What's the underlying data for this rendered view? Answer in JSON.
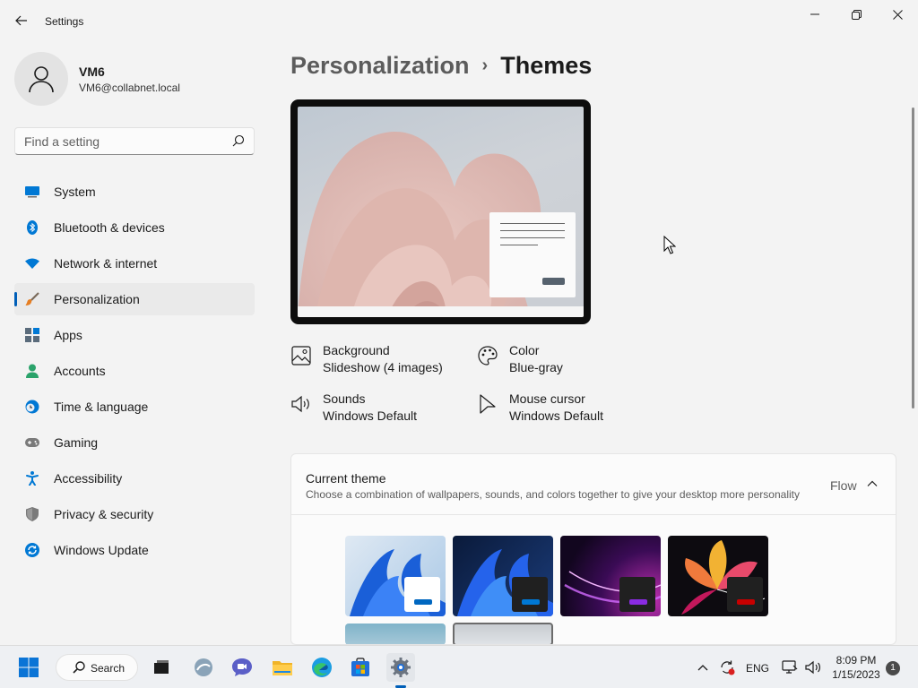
{
  "window": {
    "app_title": "Settings"
  },
  "profile": {
    "name": "VM6",
    "email": "VM6@collabnet.local"
  },
  "search": {
    "placeholder": "Find a setting"
  },
  "sidebar": {
    "items": [
      {
        "label": "System",
        "icon": "system-icon",
        "color": "#0078d4"
      },
      {
        "label": "Bluetooth & devices",
        "icon": "bluetooth-icon",
        "color": "#0078d4"
      },
      {
        "label": "Network & internet",
        "icon": "wifi-icon",
        "color": "#0078d4"
      },
      {
        "label": "Personalization",
        "icon": "paintbrush-icon",
        "color": "#e67e22",
        "active": true
      },
      {
        "label": "Apps",
        "icon": "apps-icon",
        "color": "#5a6b7b"
      },
      {
        "label": "Accounts",
        "icon": "accounts-icon",
        "color": "#2ba36b"
      },
      {
        "label": "Time & language",
        "icon": "clock-globe-icon",
        "color": "#0078d4"
      },
      {
        "label": "Gaming",
        "icon": "gamepad-icon",
        "color": "#6b6b6b"
      },
      {
        "label": "Accessibility",
        "icon": "accessibility-icon",
        "color": "#0078d4"
      },
      {
        "label": "Privacy & security",
        "icon": "shield-icon",
        "color": "#6b6b6b"
      },
      {
        "label": "Windows Update",
        "icon": "update-icon",
        "color": "#0078d4"
      }
    ]
  },
  "breadcrumb": {
    "parent": "Personalization",
    "separator": "›",
    "current": "Themes"
  },
  "properties": {
    "background": {
      "name": "Background",
      "value": "Slideshow (4 images)"
    },
    "color": {
      "name": "Color",
      "value": "Blue-gray"
    },
    "sounds": {
      "name": "Sounds",
      "value": "Windows Default"
    },
    "mouse_cursor": {
      "name": "Mouse cursor",
      "value": "Windows Default"
    }
  },
  "current_theme": {
    "title": "Current theme",
    "subtitle": "Choose a combination of wallpapers, sounds, and colors together to give your desktop more personality",
    "value": "Flow"
  },
  "themes": [
    {
      "name": "windows-light",
      "accent": "#0067c0",
      "box": "#ffffff"
    },
    {
      "name": "windows-dark",
      "accent": "#0078d4",
      "box": "#202020"
    },
    {
      "name": "glow",
      "accent": "#8a2be2",
      "box": "#202020"
    },
    {
      "name": "captured-motion",
      "accent": "#c80000",
      "box": "#202020"
    },
    {
      "name": "sunrise",
      "accent": "#3a8fb7",
      "box": "#ffffff"
    },
    {
      "name": "flow",
      "accent": "#6b7a88",
      "box": "#ffffff"
    }
  ],
  "taskbar": {
    "search_label": "Search",
    "language": "ENG",
    "time": "8:09 PM",
    "date": "1/15/2023",
    "notification_count": "1"
  },
  "colors": {
    "accent": "#005fb8",
    "window_bg": "#f3f3f3"
  }
}
